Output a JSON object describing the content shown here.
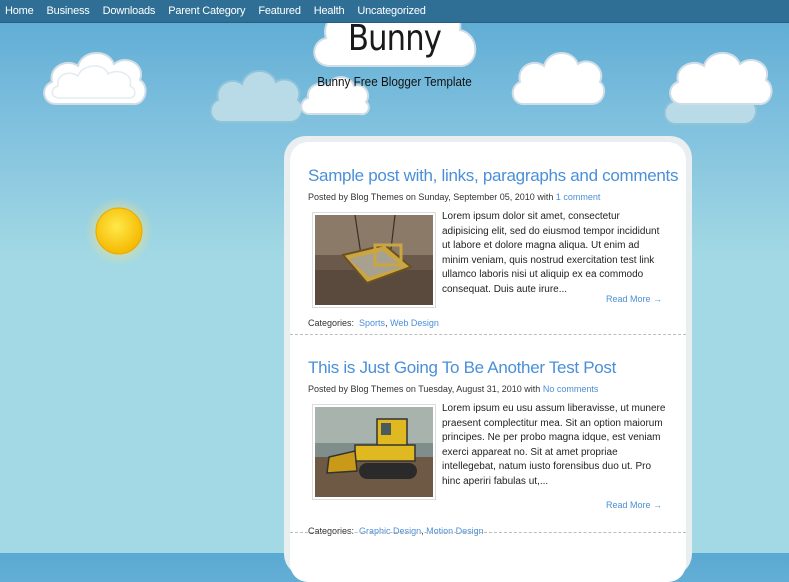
{
  "nav": {
    "items": [
      "Home",
      "Business",
      "Downloads",
      "Parent Category",
      "Featured",
      "Health",
      "Uncategorized"
    ]
  },
  "header": {
    "title": "Bunny",
    "tagline": "Bunny Free Blogger Template"
  },
  "colors": {
    "nav_bg": "#2f6f96",
    "link": "#4a8fd8",
    "sky_top": "#5aa9d3",
    "sky_bottom": "#a3d9e4",
    "sun": "#f5c400"
  },
  "posts": [
    {
      "title": "Sample post with, links, paragraphs and comments",
      "meta_prefix": "Posted by Blog Themes on Sunday, September 05, 2010 with ",
      "comments": "1 comment",
      "excerpt": "Lorem ipsum dolor sit amet, consectetur adipisicing elit, sed do eiusmod tempor incididunt ut labore et dolore magna aliqua. Ut enim ad minim veniam, quis nostrud exercitation test link ullamco laboris nisi ut aliquip ex ea commodo consequat. Duis aute irure...",
      "read_more": "Read More →",
      "categories_label": "Categories:",
      "categories": [
        "Sports",
        "Web Design"
      ],
      "thumbnail": "swing-photo"
    },
    {
      "title": "This is Just Going To Be Another Test Post",
      "meta_prefix": "Posted by Blog Themes on Tuesday, August 31, 2010 with ",
      "comments": "No comments",
      "excerpt": "Lorem ipsum eu usu assum liberavisse, ut munere praesent complectitur mea. Sit an option maiorum principes. Ne per probo magna idque, est veniam exerci appareat no. Sit at amet propriae intellegebat, natum iusto forensibus duo ut. Pro hinc aperiri fabulas ut,...",
      "read_more": "Read More →",
      "categories_label": "Categories:",
      "categories": [
        "Graphic Design",
        "Motion Design"
      ],
      "thumbnail": "bulldozer-photo"
    }
  ]
}
